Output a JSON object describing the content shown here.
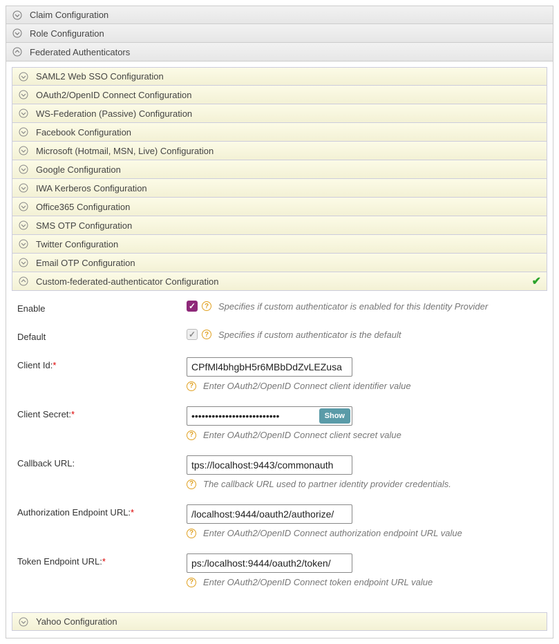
{
  "topAccordions": [
    {
      "label": "Claim Configuration",
      "expanded": false
    },
    {
      "label": "Role Configuration",
      "expanded": false
    },
    {
      "label": "Federated Authenticators",
      "expanded": true
    }
  ],
  "subAccordions": [
    {
      "label": "SAML2 Web SSO Configuration",
      "expanded": false
    },
    {
      "label": "OAuth2/OpenID Connect Configuration",
      "expanded": false
    },
    {
      "label": "WS-Federation (Passive) Configuration",
      "expanded": false
    },
    {
      "label": "Facebook Configuration",
      "expanded": false
    },
    {
      "label": "Microsoft (Hotmail, MSN, Live) Configuration",
      "expanded": false
    },
    {
      "label": "Google Configuration",
      "expanded": false
    },
    {
      "label": "IWA Kerberos Configuration",
      "expanded": false
    },
    {
      "label": "Office365 Configuration",
      "expanded": false
    },
    {
      "label": "SMS OTP Configuration",
      "expanded": false
    },
    {
      "label": "Twitter Configuration",
      "expanded": false
    },
    {
      "label": "Email OTP Configuration",
      "expanded": false
    },
    {
      "label": "Custom-federated-authenticator Configuration",
      "expanded": true,
      "checked": true
    }
  ],
  "bottomAccordion": {
    "label": "Yahoo Configuration",
    "expanded": false
  },
  "form": {
    "enable": {
      "label": "Enable",
      "checked": true,
      "hint": "Specifies if custom authenticator is enabled for this Identity Provider"
    },
    "default": {
      "label": "Default",
      "checked": true,
      "disabled": true,
      "hint": "Specifies if custom authenticator is the default"
    },
    "clientId": {
      "label": "Client Id:",
      "required": true,
      "value": "CPfMl4bhgbH5r6MBbDdZvLEZusa",
      "hint": "Enter OAuth2/OpenID Connect client identifier value"
    },
    "clientSecret": {
      "label": "Client Secret:",
      "required": true,
      "value": "••••••••••••••••••••••••••",
      "showLabel": "Show",
      "hint": "Enter OAuth2/OpenID Connect client secret value"
    },
    "callbackUrl": {
      "label": "Callback URL:",
      "required": false,
      "value": "tps://localhost:9443/commonauth",
      "hint": "The callback URL used to partner identity provider credentials."
    },
    "authzEndpoint": {
      "label": "Authorization Endpoint URL:",
      "required": true,
      "value": "/localhost:9444/oauth2/authorize/",
      "hint": "Enter OAuth2/OpenID Connect authorization endpoint URL value"
    },
    "tokenEndpoint": {
      "label": "Token Endpoint URL:",
      "required": true,
      "value": "ps:/localhost:9444/oauth2/token/",
      "hint": "Enter OAuth2/OpenID Connect token endpoint URL value"
    }
  }
}
